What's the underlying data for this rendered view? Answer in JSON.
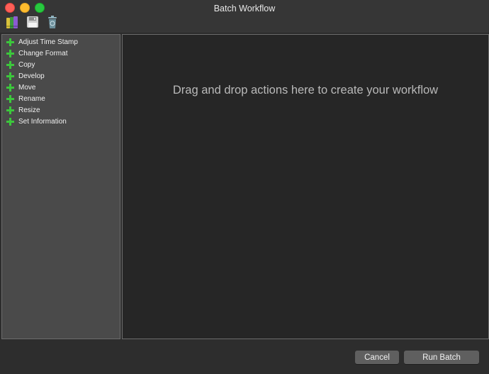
{
  "window": {
    "title": "Batch Workflow"
  },
  "toolbar": {
    "items": [
      {
        "icon": "books-icon"
      },
      {
        "icon": "save-disk-icon"
      },
      {
        "icon": "trash-icon"
      }
    ]
  },
  "sidebar": {
    "icon": "plus-icon",
    "accent": "#3cc73c",
    "items": [
      {
        "label": "Adjust Time Stamp"
      },
      {
        "label": "Change Format"
      },
      {
        "label": "Copy"
      },
      {
        "label": "Develop"
      },
      {
        "label": "Move"
      },
      {
        "label": "Rename"
      },
      {
        "label": "Resize"
      },
      {
        "label": "Set Information"
      }
    ]
  },
  "dropzone": {
    "hint": "Drag and drop actions here to create your workflow"
  },
  "footer": {
    "cancel_label": "Cancel",
    "run_label": "Run Batch"
  }
}
